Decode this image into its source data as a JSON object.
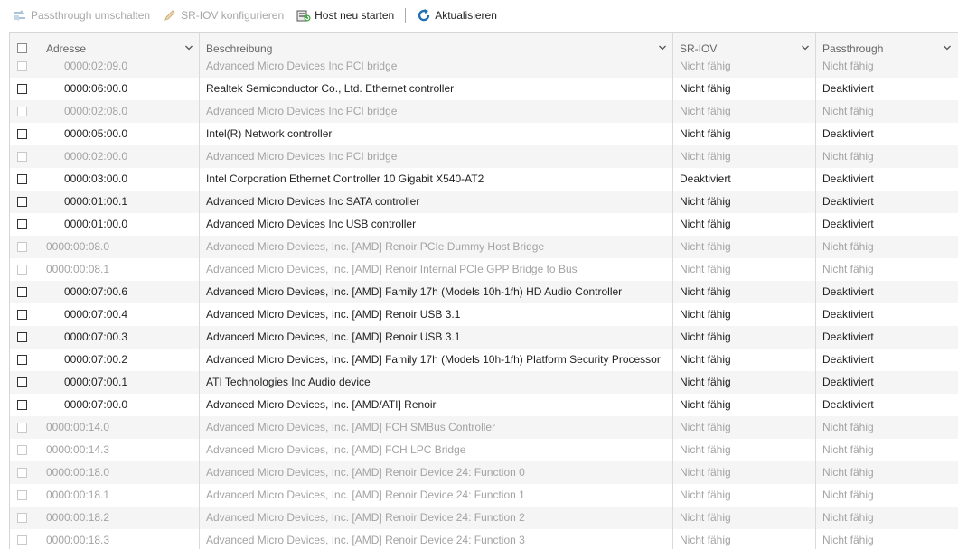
{
  "toolbar": {
    "passthrough_toggle": "Passthrough umschalten",
    "sriov_configure": "SR-IOV konfigurieren",
    "host_restart": "Host neu starten",
    "refresh": "Aktualisieren"
  },
  "columns": {
    "address": "Adresse",
    "description": "Beschreibung",
    "sriov": "SR-IOV",
    "passthrough": "Passthrough"
  },
  "rows": [
    {
      "address": "0000:02:09.0",
      "description": "Advanced Micro Devices Inc PCI bridge",
      "sriov": "Nicht fähig",
      "passthrough": "Nicht fähig",
      "enabled": false,
      "indent": true
    },
    {
      "address": "0000:06:00.0",
      "description": "Realtek Semiconductor Co., Ltd. Ethernet controller",
      "sriov": "Nicht fähig",
      "passthrough": "Deaktiviert",
      "enabled": true,
      "indent": true
    },
    {
      "address": "0000:02:08.0",
      "description": "Advanced Micro Devices Inc PCI bridge",
      "sriov": "Nicht fähig",
      "passthrough": "Nicht fähig",
      "enabled": false,
      "indent": true
    },
    {
      "address": "0000:05:00.0",
      "description": "Intel(R) Network controller",
      "sriov": "Nicht fähig",
      "passthrough": "Deaktiviert",
      "enabled": true,
      "indent": true
    },
    {
      "address": "0000:02:00.0",
      "description": "Advanced Micro Devices Inc PCI bridge",
      "sriov": "Nicht fähig",
      "passthrough": "Nicht fähig",
      "enabled": false,
      "indent": true
    },
    {
      "address": "0000:03:00.0",
      "description": "Intel Corporation Ethernet Controller 10 Gigabit X540-AT2",
      "sriov": "Deaktiviert",
      "passthrough": "Deaktiviert",
      "enabled": true,
      "indent": true
    },
    {
      "address": "0000:01:00.1",
      "description": "Advanced Micro Devices Inc SATA controller",
      "sriov": "Nicht fähig",
      "passthrough": "Deaktiviert",
      "enabled": true,
      "indent": true
    },
    {
      "address": "0000:01:00.0",
      "description": "Advanced Micro Devices Inc USB controller",
      "sriov": "Nicht fähig",
      "passthrough": "Deaktiviert",
      "enabled": true,
      "indent": true
    },
    {
      "address": "0000:00:08.0",
      "description": "Advanced Micro Devices, Inc. [AMD] Renoir PCIe Dummy Host Bridge",
      "sriov": "Nicht fähig",
      "passthrough": "Nicht fähig",
      "enabled": false,
      "indent": false
    },
    {
      "address": "0000:00:08.1",
      "description": "Advanced Micro Devices, Inc. [AMD] Renoir Internal PCIe GPP Bridge to Bus",
      "sriov": "Nicht fähig",
      "passthrough": "Nicht fähig",
      "enabled": false,
      "indent": false
    },
    {
      "address": "0000:07:00.6",
      "description": "Advanced Micro Devices, Inc. [AMD] Family 17h (Models 10h-1fh) HD Audio Controller",
      "sriov": "Nicht fähig",
      "passthrough": "Deaktiviert",
      "enabled": true,
      "indent": true
    },
    {
      "address": "0000:07:00.4",
      "description": "Advanced Micro Devices, Inc. [AMD] Renoir USB 3.1",
      "sriov": "Nicht fähig",
      "passthrough": "Deaktiviert",
      "enabled": true,
      "indent": true
    },
    {
      "address": "0000:07:00.3",
      "description": "Advanced Micro Devices, Inc. [AMD] Renoir USB 3.1",
      "sriov": "Nicht fähig",
      "passthrough": "Deaktiviert",
      "enabled": true,
      "indent": true
    },
    {
      "address": "0000:07:00.2",
      "description": "Advanced Micro Devices, Inc. [AMD] Family 17h (Models 10h-1fh) Platform Security Processor",
      "sriov": "Nicht fähig",
      "passthrough": "Deaktiviert",
      "enabled": true,
      "indent": true
    },
    {
      "address": "0000:07:00.1",
      "description": "ATI Technologies Inc Audio device",
      "sriov": "Nicht fähig",
      "passthrough": "Deaktiviert",
      "enabled": true,
      "indent": true
    },
    {
      "address": "0000:07:00.0",
      "description": "Advanced Micro Devices, Inc. [AMD/ATI] Renoir",
      "sriov": "Nicht fähig",
      "passthrough": "Deaktiviert",
      "enabled": true,
      "indent": true
    },
    {
      "address": "0000:00:14.0",
      "description": "Advanced Micro Devices, Inc. [AMD] FCH SMBus Controller",
      "sriov": "Nicht fähig",
      "passthrough": "Nicht fähig",
      "enabled": false,
      "indent": false
    },
    {
      "address": "0000:00:14.3",
      "description": "Advanced Micro Devices, Inc. [AMD] FCH LPC Bridge",
      "sriov": "Nicht fähig",
      "passthrough": "Nicht fähig",
      "enabled": false,
      "indent": false
    },
    {
      "address": "0000:00:18.0",
      "description": "Advanced Micro Devices, Inc. [AMD] Renoir Device 24: Function 0",
      "sriov": "Nicht fähig",
      "passthrough": "Nicht fähig",
      "enabled": false,
      "indent": false
    },
    {
      "address": "0000:00:18.1",
      "description": "Advanced Micro Devices, Inc. [AMD] Renoir Device 24: Function 1",
      "sriov": "Nicht fähig",
      "passthrough": "Nicht fähig",
      "enabled": false,
      "indent": false
    },
    {
      "address": "0000:00:18.2",
      "description": "Advanced Micro Devices, Inc. [AMD] Renoir Device 24: Function 2",
      "sriov": "Nicht fähig",
      "passthrough": "Nicht fähig",
      "enabled": false,
      "indent": false
    },
    {
      "address": "0000:00:18.3",
      "description": "Advanced Micro Devices, Inc. [AMD] Renoir Device 24: Function 3",
      "sriov": "Nicht fähig",
      "passthrough": "Nicht fähig",
      "enabled": false,
      "indent": false
    }
  ]
}
